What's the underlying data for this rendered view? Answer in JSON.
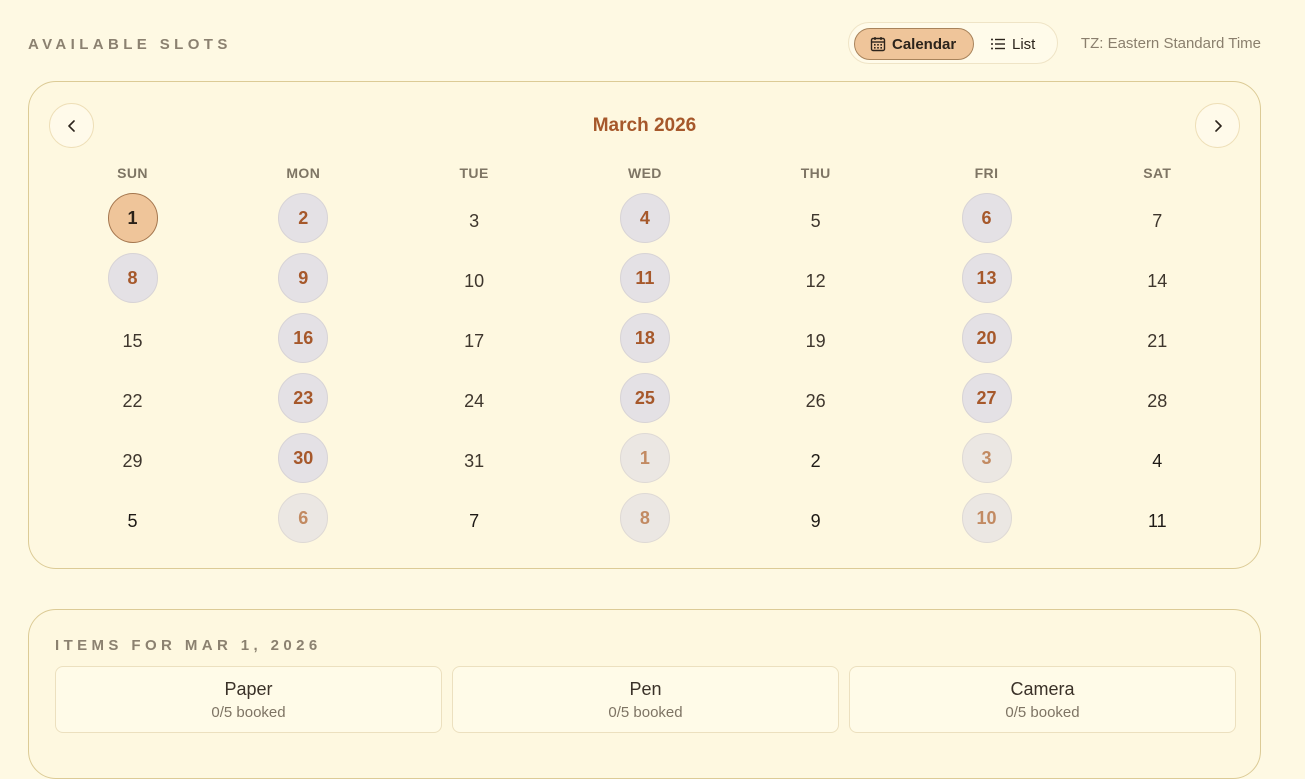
{
  "header": {
    "title": "AVAILABLE SLOTS",
    "views": [
      {
        "label": "Calendar",
        "icon": "calendar-icon",
        "active": true
      },
      {
        "label": "List",
        "icon": "list-icon",
        "active": false
      }
    ],
    "timezone": "TZ: Eastern Standard Time"
  },
  "calendar": {
    "month_label": "March 2026",
    "weekdays": [
      "SUN",
      "MON",
      "TUE",
      "WED",
      "THU",
      "FRI",
      "SAT"
    ],
    "weeks": [
      [
        {
          "day": "1",
          "state": "selected"
        },
        {
          "day": "2",
          "state": "available"
        },
        {
          "day": "3",
          "state": "plain"
        },
        {
          "day": "4",
          "state": "available"
        },
        {
          "day": "5",
          "state": "plain"
        },
        {
          "day": "6",
          "state": "available"
        },
        {
          "day": "7",
          "state": "plain"
        }
      ],
      [
        {
          "day": "8",
          "state": "available"
        },
        {
          "day": "9",
          "state": "available"
        },
        {
          "day": "10",
          "state": "plain"
        },
        {
          "day": "11",
          "state": "available"
        },
        {
          "day": "12",
          "state": "plain"
        },
        {
          "day": "13",
          "state": "available"
        },
        {
          "day": "14",
          "state": "plain"
        }
      ],
      [
        {
          "day": "15",
          "state": "plain"
        },
        {
          "day": "16",
          "state": "available"
        },
        {
          "day": "17",
          "state": "plain"
        },
        {
          "day": "18",
          "state": "available"
        },
        {
          "day": "19",
          "state": "plain"
        },
        {
          "day": "20",
          "state": "available"
        },
        {
          "day": "21",
          "state": "plain"
        }
      ],
      [
        {
          "day": "22",
          "state": "plain"
        },
        {
          "day": "23",
          "state": "available"
        },
        {
          "day": "24",
          "state": "plain"
        },
        {
          "day": "25",
          "state": "available"
        },
        {
          "day": "26",
          "state": "plain"
        },
        {
          "day": "27",
          "state": "available"
        },
        {
          "day": "28",
          "state": "plain"
        }
      ],
      [
        {
          "day": "29",
          "state": "plain"
        },
        {
          "day": "30",
          "state": "available"
        },
        {
          "day": "31",
          "state": "plain"
        },
        {
          "day": "1",
          "state": "outside-available"
        },
        {
          "day": "2",
          "state": "outside"
        },
        {
          "day": "3",
          "state": "outside-available"
        },
        {
          "day": "4",
          "state": "outside"
        }
      ],
      [
        {
          "day": "5",
          "state": "outside"
        },
        {
          "day": "6",
          "state": "outside-available"
        },
        {
          "day": "7",
          "state": "outside"
        },
        {
          "day": "8",
          "state": "outside-available"
        },
        {
          "day": "9",
          "state": "outside"
        },
        {
          "day": "10",
          "state": "outside-available"
        },
        {
          "day": "11",
          "state": "outside"
        }
      ]
    ]
  },
  "items": {
    "title": "ITEMS FOR MAR 1, 2026",
    "list": [
      {
        "name": "Paper",
        "status": "0/5 booked"
      },
      {
        "name": "Pen",
        "status": "0/5 booked"
      },
      {
        "name": "Camera",
        "status": "0/5 booked"
      }
    ]
  },
  "colors": {
    "background": "#fef9e3",
    "accent": "#efc59a",
    "available_bg": "#e4e1e5",
    "available_text": "#a6582b",
    "border": "#dccb96"
  }
}
